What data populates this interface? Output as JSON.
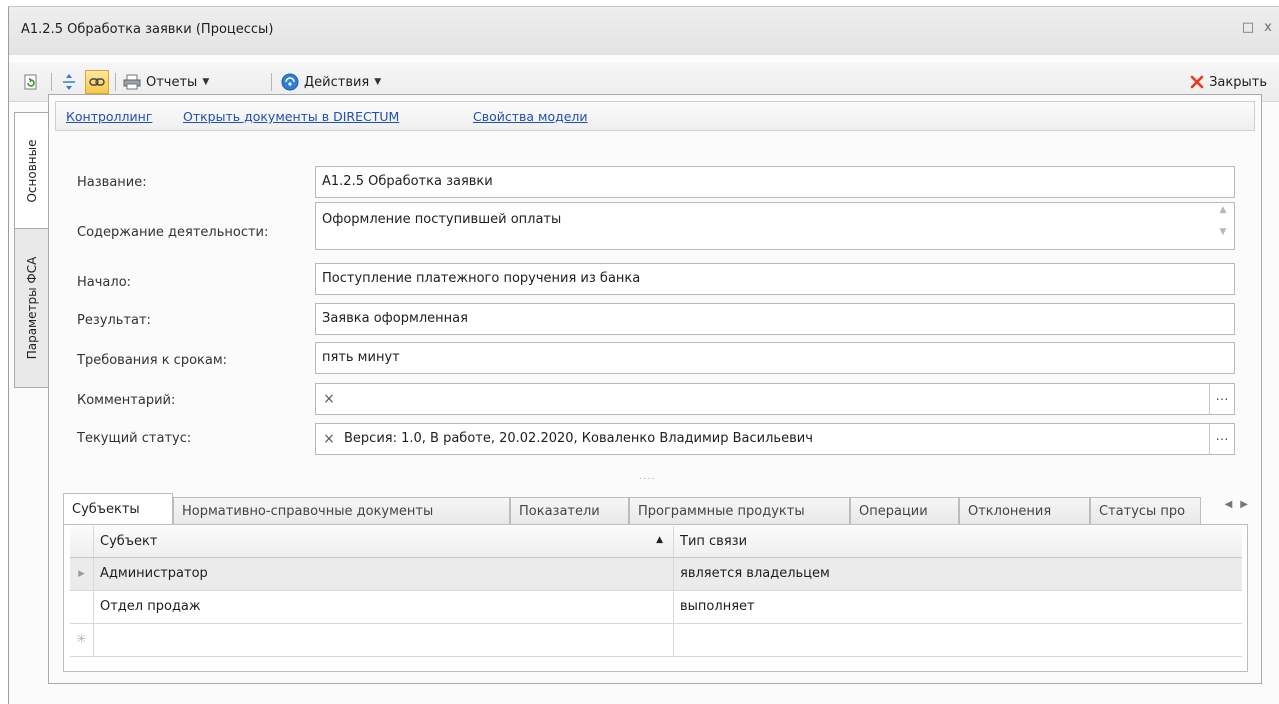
{
  "window": {
    "title": "A1.2.5 Обработка заявки (Процессы)",
    "maximize_glyph": "□",
    "close_glyph": "x"
  },
  "toolbar": {
    "reports_label": "Отчеты",
    "actions_label": "Действия",
    "close_label": "Закрыть"
  },
  "side_tabs": [
    {
      "label": "Основные",
      "active": true
    },
    {
      "label": "Параметры ФСА",
      "active": false
    }
  ],
  "links": [
    "Контроллинг",
    "Открыть документы в DIRECTUM",
    "Свойства модели"
  ],
  "form": {
    "name": {
      "label": "Название:",
      "value": "A1.2.5  Обработка заявки"
    },
    "content": {
      "label": "Содержание деятельности:",
      "value": "Оформление поступившей оплаты"
    },
    "start": {
      "label": "Начало:",
      "value": "Поступление платежного поручения из банка"
    },
    "result": {
      "label": "Результат:",
      "value": "Заявка оформленная"
    },
    "deadlines": {
      "label": "Требования к срокам:",
      "value": "пять минут"
    },
    "comment": {
      "label": "Комментарий:",
      "value": ""
    },
    "status": {
      "label": "Текущий статус:",
      "value": "Версия: 1.0, В работе, 20.02.2020, Коваленко Владимир Васильевич"
    }
  },
  "splitter_glyph": "....",
  "tabs": [
    "Субъекты",
    "Нормативно-справочные документы",
    "Показатели",
    "Программные продукты",
    "Операции",
    "Отклонения",
    "Статусы про"
  ],
  "active_tab": 0,
  "grid": {
    "columns": [
      "Субъект",
      "Тип связи"
    ],
    "rows": [
      {
        "subject": "Администратор",
        "link_type": "является владельцем",
        "selected": true
      },
      {
        "subject": "Отдел продаж",
        "link_type": "выполняет",
        "selected": false
      }
    ],
    "current_row_glyph": "▸",
    "new_row_glyph": "✳"
  },
  "colors": {
    "link": "#1f4fb3",
    "close_x": "#e8381b",
    "refresh_icon": "#3a8a2e",
    "actions_icon": "#2f7fd4"
  }
}
